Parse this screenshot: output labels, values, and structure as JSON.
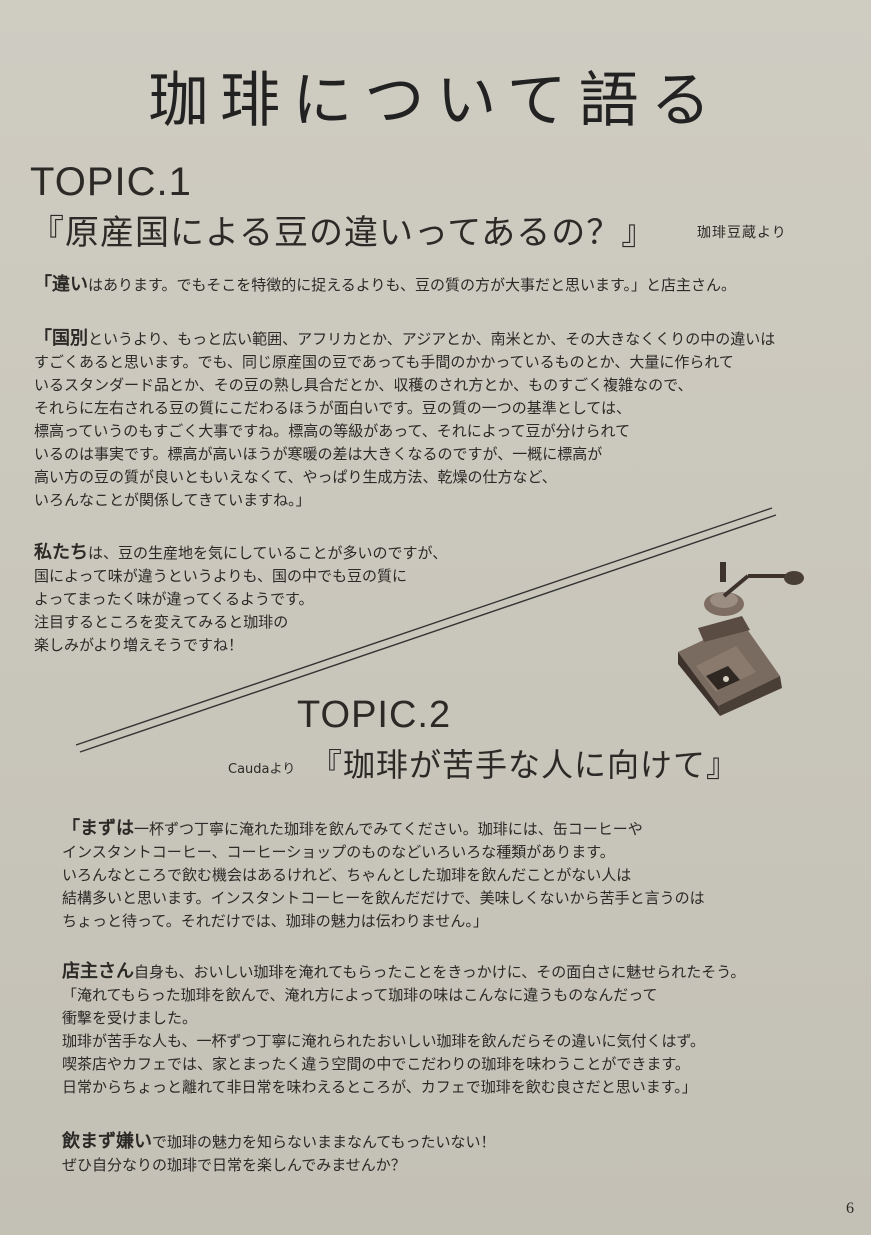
{
  "title": "珈琲について語る",
  "topic1": {
    "label": "TOPIC.1",
    "heading": "『原産国による豆の違いってあるの？』",
    "source": "珈琲豆蔵より",
    "para1_lead": "「違い",
    "para1_body": "はあります。でもそこを特徴的に捉えるよりも、豆の質の方が大事だと思います。」と店主さん。",
    "para2_lead": "「国別",
    "para2_line1": "というより、もっと広い範囲、アフリカとか、アジアとか、南米とか、その大きなくくりの中の違いは",
    "para2_lines": "すごくあると思います。でも、同じ原産国の豆であっても手間のかかっているものとか、大量に作られて\nいるスタンダード品とか、その豆の熟し具合だとか、収穫のされ方とか、ものすごく複雑なので、\nそれらに左右される豆の質にこだわるほうが面白いです。豆の質の一つの基準としては、\n標高っていうのもすごく大事ですね。標高の等級があって、それによって豆が分けられて\nいるのは事実です。標高が高いほうが寒暖の差は大きくなるのですが、一概に標高が\n高い方の豆の質が良いともいえなくて、やっぱり生成方法、乾燥の仕方など、\nいろんなことが関係してきていますね。」",
    "para3_lead": "私たち",
    "para3_line1": "は、豆の生産地を気にしていることが多いのですが、",
    "para3_lines": "国によって味が違うというよりも、国の中でも豆の質に\nよってまったく味が違ってくるようです。\n注目するところを変えてみると珈琲の\n楽しみがより増えそうですね！"
  },
  "topic2": {
    "label": "TOPIC.2",
    "source": "Caudaより",
    "heading": "『珈琲が苦手な人に向けて』",
    "para4_lead": "「まずは",
    "para4_line1": "一杯ずつ丁寧に淹れた珈琲を飲んでみてください。珈琲には、缶コーヒーや",
    "para4_lines": "インスタントコーヒー、コーヒーショップのものなどいろいろな種類があります。\nいろんなところで飲む機会はあるけれど、ちゃんとした珈琲を飲んだことがない人は\n結構多いと思います。インスタントコーヒーを飲んだだけで、美味しくないから苦手と言うのは\nちょっと待って。それだけでは、珈琲の魅力は伝わりません。」",
    "para5_lead": "店主さん",
    "para5_line1": "自身も、おいしい珈琲を淹れてもらったことをきっかけに、その面白さに魅せられたそう。",
    "para5_lines": "「淹れてもらった珈琲を飲んで、淹れ方によって珈琲の味はこんなに違うものなんだって\n衝撃を受けました。\n珈琲が苦手な人も、一杯ずつ丁寧に淹れられたおいしい珈琲を飲んだらその違いに気付くはず。\n喫茶店やカフェでは、家とまったく違う空間の中でこだわりの珈琲を味わうことができます。\n日常からちょっと離れて非日常を味わえるところが、カフェで珈琲を飲む良さだと思います。」",
    "para6_lead": "飲まず嫌い",
    "para6_line1": "で珈琲の魅力を知らないままなんてもったいない！",
    "para6_lines": "ぜひ自分なりの珈琲で日常を楽しんでみませんか？"
  },
  "page_number": "6"
}
